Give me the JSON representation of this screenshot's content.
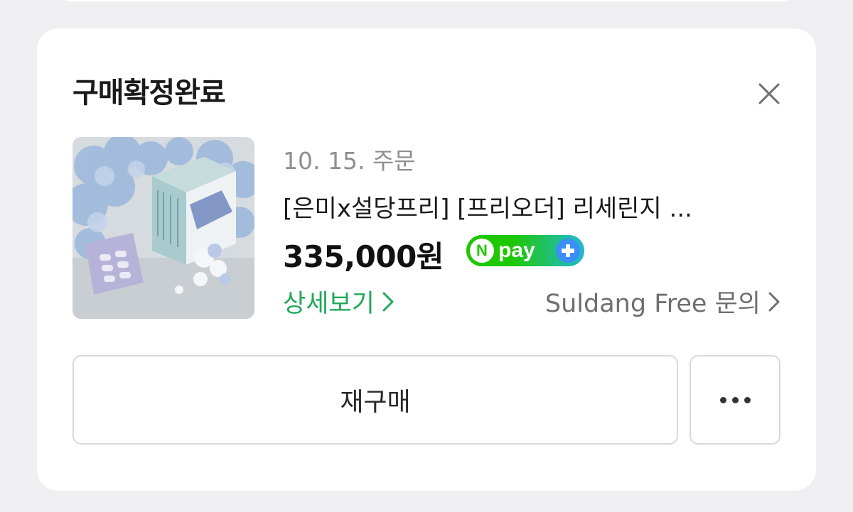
{
  "card": {
    "title": "구매확정완료",
    "close_icon": "close-icon"
  },
  "order": {
    "date": "10. 15. 주문",
    "product_name": "[은미x설당프리] [프리오더] 리세린지 ...",
    "price": "335,000원",
    "payment_badge": {
      "n_letter": "N",
      "label": "pay",
      "plus_icon": "plus-icon",
      "colors": {
        "green": "#1ec800",
        "blue": "#3a8ef6"
      }
    },
    "detail_link": "상세보기",
    "shop_link": "Suldang Free 문의"
  },
  "actions": {
    "rebuy_label": "재구매",
    "more_icon": "more-horizontal-icon"
  },
  "colors": {
    "accent_green": "#21a85a",
    "muted_text": "#8e8e93"
  }
}
